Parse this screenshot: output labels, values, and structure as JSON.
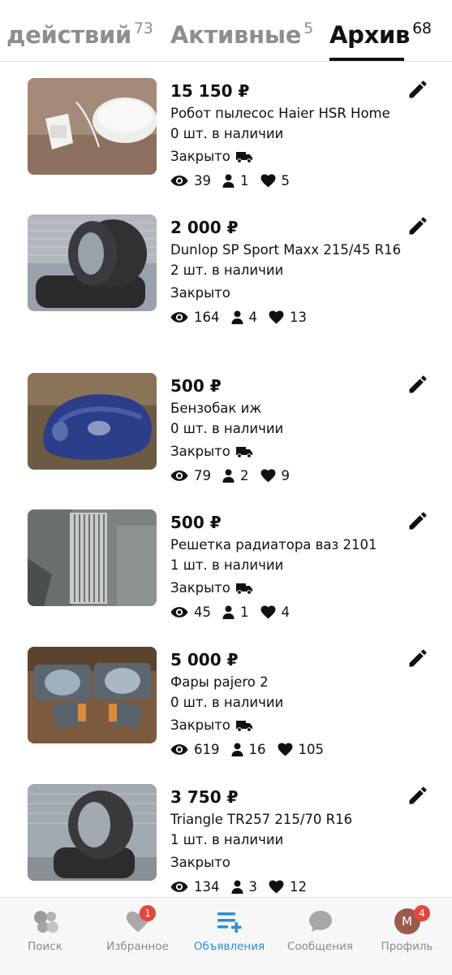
{
  "tabs": [
    {
      "label": "действий",
      "count": "73",
      "active": false
    },
    {
      "label": "Активные",
      "count": "5",
      "active": false
    },
    {
      "label": "Архив",
      "count": "68",
      "active": true
    }
  ],
  "listings": [
    {
      "price": "15 150 ₽",
      "title": "Робот пылесос Haier HSR Home",
      "stock": "0 шт. в наличии",
      "status": "Закрыто",
      "views": "39",
      "users": "1",
      "likes": "5",
      "image": "robot-vacuum"
    },
    {
      "price": "2 000 ₽",
      "title": "Dunlop SP Sport Maxx 215/45 R16",
      "stock": "2 шт. в наличии",
      "status": "Закрыто",
      "views": "164",
      "users": "4",
      "likes": "13",
      "image": "tires"
    },
    {
      "price": "500 ₽",
      "title": "Бензобак иж",
      "stock": "0 шт. в наличии",
      "status": "Закрыто",
      "views": "79",
      "users": "2",
      "likes": "9",
      "image": "fuel-tank"
    },
    {
      "price": "500 ₽",
      "title": "Решетка радиатора ваз 2101",
      "stock": "1 шт. в наличии",
      "status": "Закрыто",
      "views": "45",
      "users": "1",
      "likes": "4",
      "image": "radiator-grille"
    },
    {
      "price": "5 000 ₽",
      "title": "Фары pajero 2",
      "stock": "0 шт. в наличии",
      "status": "Закрыто",
      "views": "619",
      "users": "16",
      "likes": "105",
      "image": "headlights"
    },
    {
      "price": "3 750 ₽",
      "title": "Triangle TR257 215/70 R16",
      "stock": "1 шт. в наличии",
      "status": "Закрыто",
      "views": "134",
      "users": "3",
      "likes": "12",
      "image": "tire"
    }
  ],
  "bottom_nav": [
    {
      "label": "Поиск",
      "icon": "search-bubbles-icon",
      "badge": ""
    },
    {
      "label": "Избранное",
      "icon": "heart-icon",
      "badge": "1"
    },
    {
      "label": "Объявления",
      "icon": "listings-add-icon",
      "badge": "",
      "active": true
    },
    {
      "label": "Сообщения",
      "icon": "chat-bubble-icon",
      "badge": ""
    },
    {
      "label": "Профиль",
      "icon": "avatar",
      "badge": "4",
      "avatar_letter": "M"
    }
  ],
  "colors": {
    "accent": "#2b8de0",
    "badge": "#e8453c",
    "inactive": "#8e8e8e"
  }
}
